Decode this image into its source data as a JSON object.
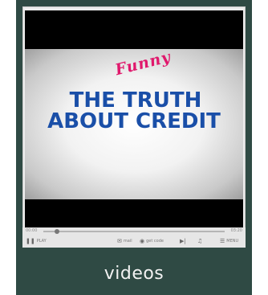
{
  "tile": {
    "label": "videos"
  },
  "video": {
    "title_script": "Funny",
    "title_line1": "THE TRUTH",
    "title_line2": "ABOUT CREDIT"
  },
  "player": {
    "elapsed": "00:00",
    "duration": "03:20",
    "progress": 0.02,
    "play_label": "PLAY",
    "mail_label": "mail",
    "link_label": "get code",
    "more_label": "MENU"
  },
  "colors": {
    "tile_bg": "#2f4a44",
    "title_blue": "#1a4fa8",
    "script_pink": "#e0186c"
  },
  "icons": {
    "play": "play-icon",
    "mail": "mail-icon",
    "link": "code-icon",
    "next": "next-icon",
    "volume": "volume-icon",
    "menu": "menu-icon"
  }
}
